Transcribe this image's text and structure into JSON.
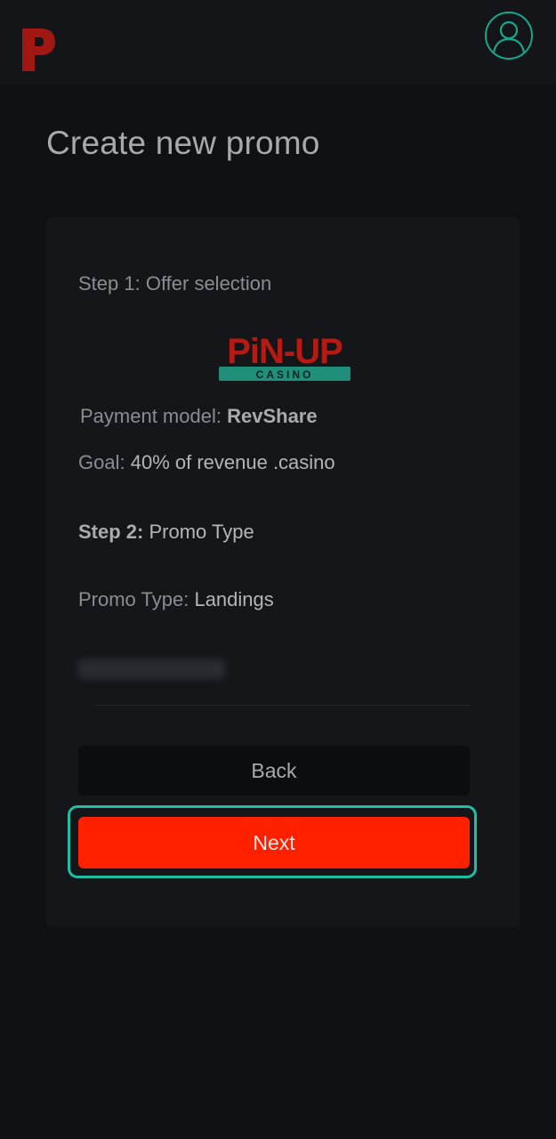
{
  "header": {
    "logo_icon": "pinup-p-logo-icon",
    "avatar_icon": "user-avatar-icon",
    "accent_color": "#1aa58d"
  },
  "page": {
    "title": "Create new promo"
  },
  "card": {
    "step1_label": "Step 1: Offer selection",
    "brand_logo": {
      "line1": "PiN-UP",
      "line2": "CASINO"
    },
    "payment_model_label": "Payment model:",
    "payment_model_value": "RevShare",
    "goal_label": "Goal:",
    "goal_value": "40% of revenue .casino",
    "step2_label": "Step 2:",
    "step2_value": "Promo Type",
    "promo_type_label": "Promo Type:",
    "promo_type_value": "Landings",
    "back_label": "Back",
    "next_label": "Next",
    "next_color": "#ff2000"
  }
}
